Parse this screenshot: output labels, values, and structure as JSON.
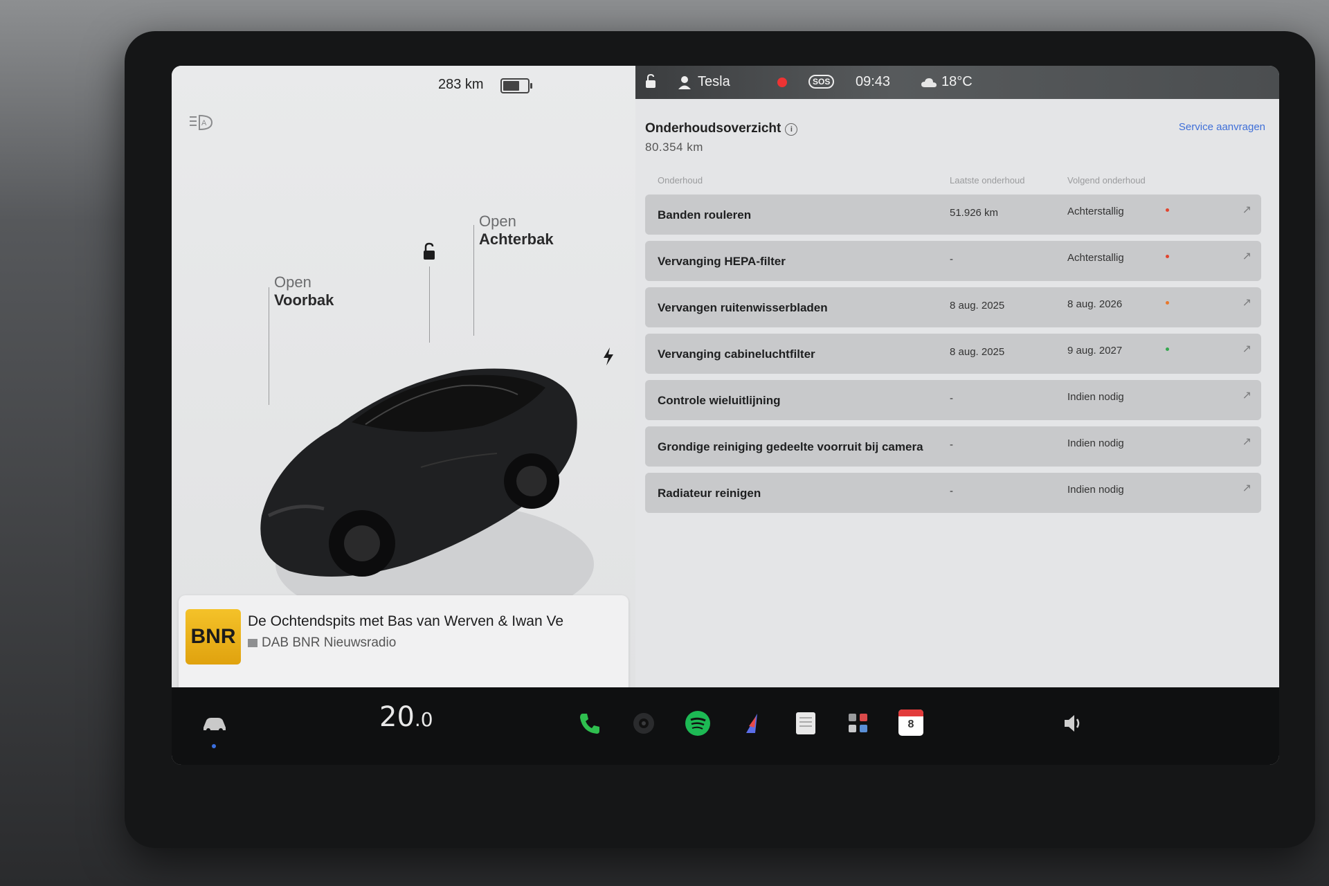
{
  "status": {
    "range": "283 km",
    "battery_level": 0.6,
    "profile_name": "Tesla",
    "sos_label": "SOS",
    "time": "09:43",
    "temperature_outside": "18°C"
  },
  "vehicle": {
    "frunk_action": "Open",
    "frunk_label": "Voorbak",
    "trunk_action": "Open",
    "trunk_label": "Achterbak"
  },
  "media": {
    "station_logo": "BNR",
    "title": "De Ochtendspits met Bas van Werven & Iwan Ve",
    "source": "DAB BNR Nieuwsradio"
  },
  "maintenance": {
    "title": "Onderhoudsoverzicht",
    "odometer": "80.354  km",
    "service_link": "Service aanvragen",
    "columns": [
      "Onderhoud",
      "Laatste onderhoud",
      "Volgend onderhoud"
    ],
    "rows": [
      {
        "name": "Banden rouleren",
        "last": "51.926 km",
        "next": "Achterstallig",
        "status_color": "#e2452f"
      },
      {
        "name": "Vervanging HEPA-filter",
        "last": "-",
        "next": "Achterstallig",
        "status_color": "#e2452f"
      },
      {
        "name": "Vervangen ruitenwisserbladen",
        "last": "8 aug. 2025",
        "next": "8 aug. 2026",
        "status_color": "#e8782d"
      },
      {
        "name": "Vervanging cabineluchtfilter",
        "last": "8 aug. 2025",
        "next": "9 aug. 2027",
        "status_color": "#35a84f"
      },
      {
        "name": "Controle wieluitlijning",
        "last": "-",
        "next": "Indien nodig",
        "status_color": ""
      },
      {
        "name": "Grondige reiniging gedeelte voorruit bij camera",
        "last": "-",
        "next": "Indien nodig",
        "status_color": ""
      },
      {
        "name": "Radiateur reinigen",
        "last": "-",
        "next": "Indien nodig",
        "status_color": ""
      }
    ]
  },
  "dock": {
    "cabin_temp": "20",
    "cabin_temp_decimal": ".0",
    "calendar_day": "8"
  },
  "colors": {
    "accent_link": "#3f6fd8",
    "spotify_green": "#1db954",
    "phone_green": "#2fbf4f",
    "record_red": "#e33333"
  }
}
